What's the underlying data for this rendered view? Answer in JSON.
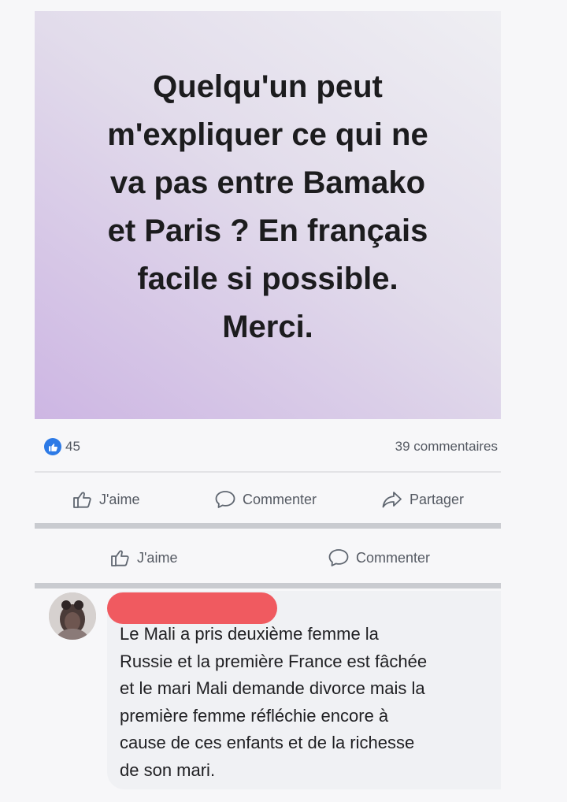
{
  "post": {
    "lines": [
      "Quelqu'un peut",
      "m'expliquer ce qui ne",
      "va pas entre Bamako",
      "et Paris ? En français",
      "facile si possible.",
      "Merci."
    ],
    "background_colors": [
      "#efeff3",
      "#cdb6e3"
    ]
  },
  "reactions": {
    "like_count": "45",
    "comments_count": "39 commentaires",
    "accent_color": "#2d7ae6"
  },
  "actions": {
    "like_label": "J'aime",
    "comment_label": "Commenter",
    "share_label": "Partager",
    "icons": [
      "thumbs-up-icon",
      "comment-icon",
      "share-icon"
    ]
  },
  "secondary_actions": {
    "like_label": "J'aime",
    "comment_label": "Commenter"
  },
  "comment": {
    "lines": [
      "Le Mali a pris deuxième femme la",
      "Russie et la première France est fâchée",
      "et le mari Mali demande divorce mais la",
      "première femme réfléchie encore à",
      "cause de ces enfants et de la richesse",
      "de son mari."
    ],
    "redaction_color": "#f05a60"
  }
}
